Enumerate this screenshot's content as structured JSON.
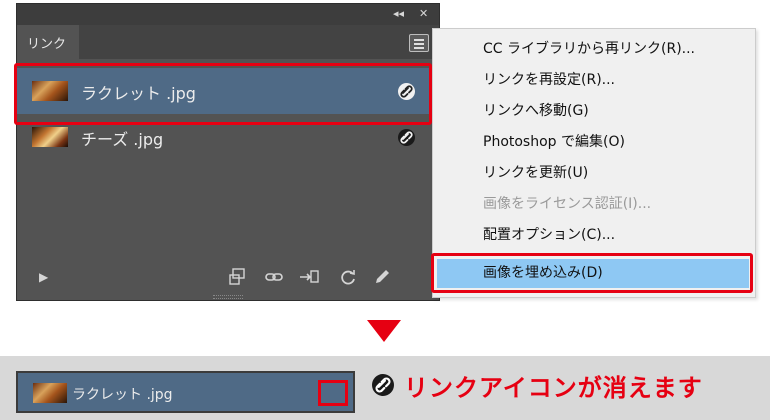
{
  "panel": {
    "tab_label": "リンク",
    "topbar_collapse": "◂◂",
    "topbar_close": "✕",
    "links": [
      {
        "name": "ラクレット .jpg",
        "status_icon": "link-chain-icon"
      },
      {
        "name": "チーズ .jpg",
        "status_icon": "link-chain-icon"
      }
    ],
    "footer_icons": [
      "play-icon",
      "relink-from-cc-icon",
      "relink-icon",
      "goto-link-icon",
      "update-link-icon",
      "edit-original-icon"
    ]
  },
  "context_menu": {
    "items": [
      {
        "label": "CC ライブラリから再リンク(R)...",
        "enabled": true
      },
      {
        "label": "リンクを再設定(R)...",
        "enabled": true
      },
      {
        "label": "リンクへ移動(G)",
        "enabled": true
      },
      {
        "label": "Photoshop で編集(O)",
        "enabled": true
      },
      {
        "label": "リンクを更新(U)",
        "enabled": true
      },
      {
        "label": "画像をライセンス認証(I)...",
        "enabled": false
      },
      {
        "label": "配置オプション(C)...",
        "enabled": true
      },
      {
        "label": "画像を埋め込み(D)",
        "enabled": true,
        "highlighted": true
      }
    ]
  },
  "result": {
    "link_name": "ラクレット .jpg",
    "caption": "リンクアイコンが消えます"
  },
  "colors": {
    "accent_red": "#e60012",
    "selected_row": "#4f6a86",
    "menu_highlight": "#8ec8f3",
    "panel_bg": "#535353"
  }
}
